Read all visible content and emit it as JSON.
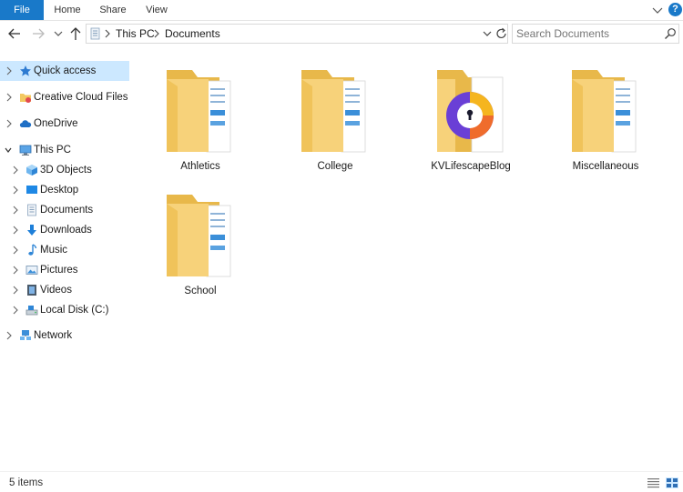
{
  "ribbon": {
    "tabs": [
      "File",
      "Home",
      "Share",
      "View"
    ],
    "help_glyph": "?"
  },
  "address": {
    "crumbs": [
      "This PC",
      "Documents"
    ]
  },
  "search": {
    "placeholder": "Search Documents"
  },
  "sidebar": {
    "items": [
      {
        "label": "Quick access",
        "icon": "star-icon",
        "selected": true
      },
      {
        "label": "Creative Cloud Files",
        "icon": "creative-cloud-icon"
      },
      {
        "label": "OneDrive",
        "icon": "cloud-icon"
      },
      {
        "label": "This PC",
        "icon": "computer-icon",
        "expanded": true
      },
      {
        "label": "3D Objects",
        "icon": "cube-icon"
      },
      {
        "label": "Desktop",
        "icon": "desktop-icon"
      },
      {
        "label": "Documents",
        "icon": "document-icon"
      },
      {
        "label": "Downloads",
        "icon": "download-arrow-icon"
      },
      {
        "label": "Music",
        "icon": "music-note-icon"
      },
      {
        "label": "Pictures",
        "icon": "picture-icon"
      },
      {
        "label": "Videos",
        "icon": "film-icon"
      },
      {
        "label": "Local Disk (C:)",
        "icon": "drive-icon"
      },
      {
        "label": "Network",
        "icon": "network-icon"
      }
    ]
  },
  "files": [
    {
      "name": "Athletics",
      "icon": "folder-icon"
    },
    {
      "name": "College",
      "icon": "folder-icon"
    },
    {
      "name": "KVLifescapeBlog",
      "icon": "password-manager-folder-icon"
    },
    {
      "name": "Miscellaneous",
      "icon": "folder-icon"
    },
    {
      "name": "School",
      "icon": "folder-icon"
    }
  ],
  "status": {
    "item_count": "5 items"
  },
  "colors": {
    "accent": "#1979c9",
    "selection": "#cce8ff",
    "folder": "#f5c95a"
  }
}
